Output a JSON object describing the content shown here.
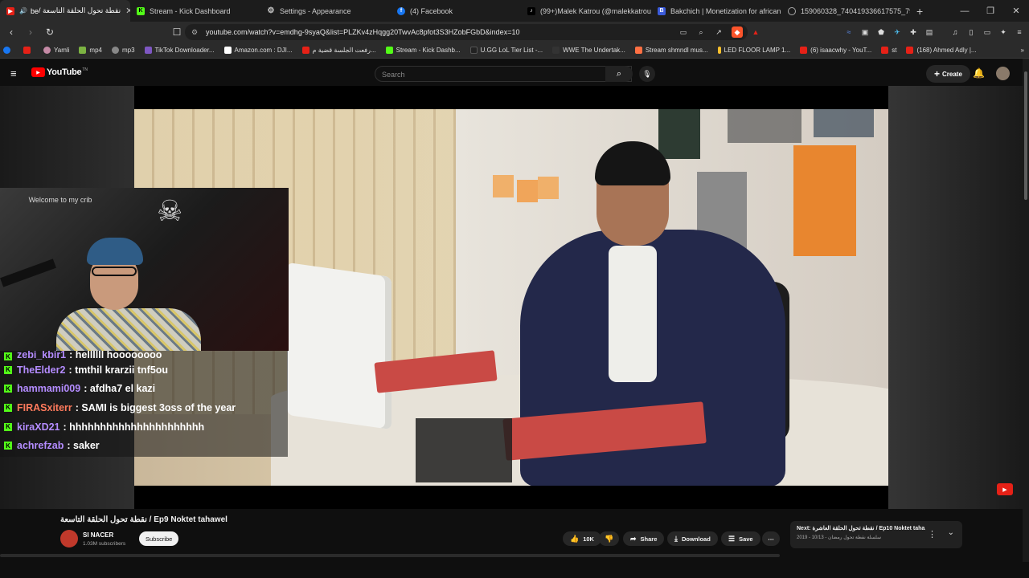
{
  "tabs": [
    {
      "label": "نقطة تحول الحلقة التاسعة / ",
      "prefix": "be",
      "color": "#e62117",
      "active": true
    },
    {
      "label": "Stream - Kick Dashboard",
      "color": "#53fc18"
    },
    {
      "label": "Settings - Appearance",
      "color": "#9aa0a6"
    },
    {
      "label": "(4) Facebook",
      "color": "#1877f2"
    },
    {
      "label": "(99+)Malek Katrou (@malekkatrou)",
      "color": "#000000"
    },
    {
      "label": "Bakchich | Monetization for african c",
      "color": "#3b5bdb"
    },
    {
      "label": "159060328_740419336617575_7964",
      "color": "#9aa0a6"
    }
  ],
  "address": {
    "url": "youtube.com/watch?v=emdhg-9syaQ&list=PLZKv4zHqgg20TwvAc8pfot3S3HZobFGbD&index=10"
  },
  "bookmarks": [
    {
      "label": "",
      "color": "#1877f2"
    },
    {
      "label": "",
      "color": "#e62117"
    },
    {
      "label": "Yamli",
      "color": "#c9a"
    },
    {
      "label": "mp4",
      "color": "#7cb342"
    },
    {
      "label": "mp3",
      "color": "#888"
    },
    {
      "label": "TikTok Downloader...",
      "color": "#7e57c2"
    },
    {
      "label": "Amazon.com : DJI...",
      "color": "#fff"
    },
    {
      "label": "رفعت الجلسة قضية م...",
      "color": "#e62117"
    },
    {
      "label": "Stream - Kick Dashb...",
      "color": "#53fc18"
    },
    {
      "label": "U.GG LoL Tier List -...",
      "color": "#222"
    },
    {
      "label": "WWE The Undertak...",
      "color": "#333"
    },
    {
      "label": "Stream shmndl mus...",
      "color": "#ff7043"
    },
    {
      "label": "LED FLOOR LAMP 1...",
      "color": "#fbc02d"
    },
    {
      "label": "(6) isaacwhy - YouT...",
      "color": "#e62117"
    },
    {
      "label": "st",
      "color": "#e62117"
    },
    {
      "label": "(168) Ahmed Adly |...",
      "color": "#e62117"
    }
  ],
  "youtube": {
    "logo": "YouTube",
    "logo_sup": "TN",
    "search_placeholder": "Search",
    "create_label": "Create"
  },
  "webcam": {
    "welcome_text": "Welcome to my crib"
  },
  "chat": [
    {
      "user": "zebi_kbir1",
      "user_color": "#b48cff",
      "msg": ": hellllll hoooooooo",
      "partial": true
    },
    {
      "user": "TheElder2",
      "user_color": "#b48cff",
      "msg": ": tmthil krarzii tnf5ou"
    },
    {
      "user": "hammami009",
      "user_color": "#b48cff",
      "msg": ": afdha7 el kazi"
    },
    {
      "user": "FIRASxiterr",
      "user_color": "#ff7a5c",
      "msg": ": SAMI is biggest 3oss of the year"
    },
    {
      "user": "kiraXD21",
      "user_color": "#b48cff",
      "msg": ": hhhhhhhhhhhhhhhhhhhhhh"
    },
    {
      "user": "achrefzab",
      "user_color": "#b48cff",
      "msg": ": saker"
    }
  ],
  "video": {
    "title": "نقطة تحول الحلقة التاسعة / Ep9 Noktet tahawel",
    "channel": "SI NACER",
    "subscribers": "1.03M subscribers",
    "subscribe_label": "Subscribe",
    "likes": "10K",
    "share_label": "Share",
    "download_label": "Download",
    "save_label": "Save"
  },
  "next": {
    "title": "Next: نقطة تحول الحلقة العاشرة / Ep10 Noktet taha...",
    "sub": "2019 - سلسلة نقطة تحول رمضان - 10/13"
  }
}
